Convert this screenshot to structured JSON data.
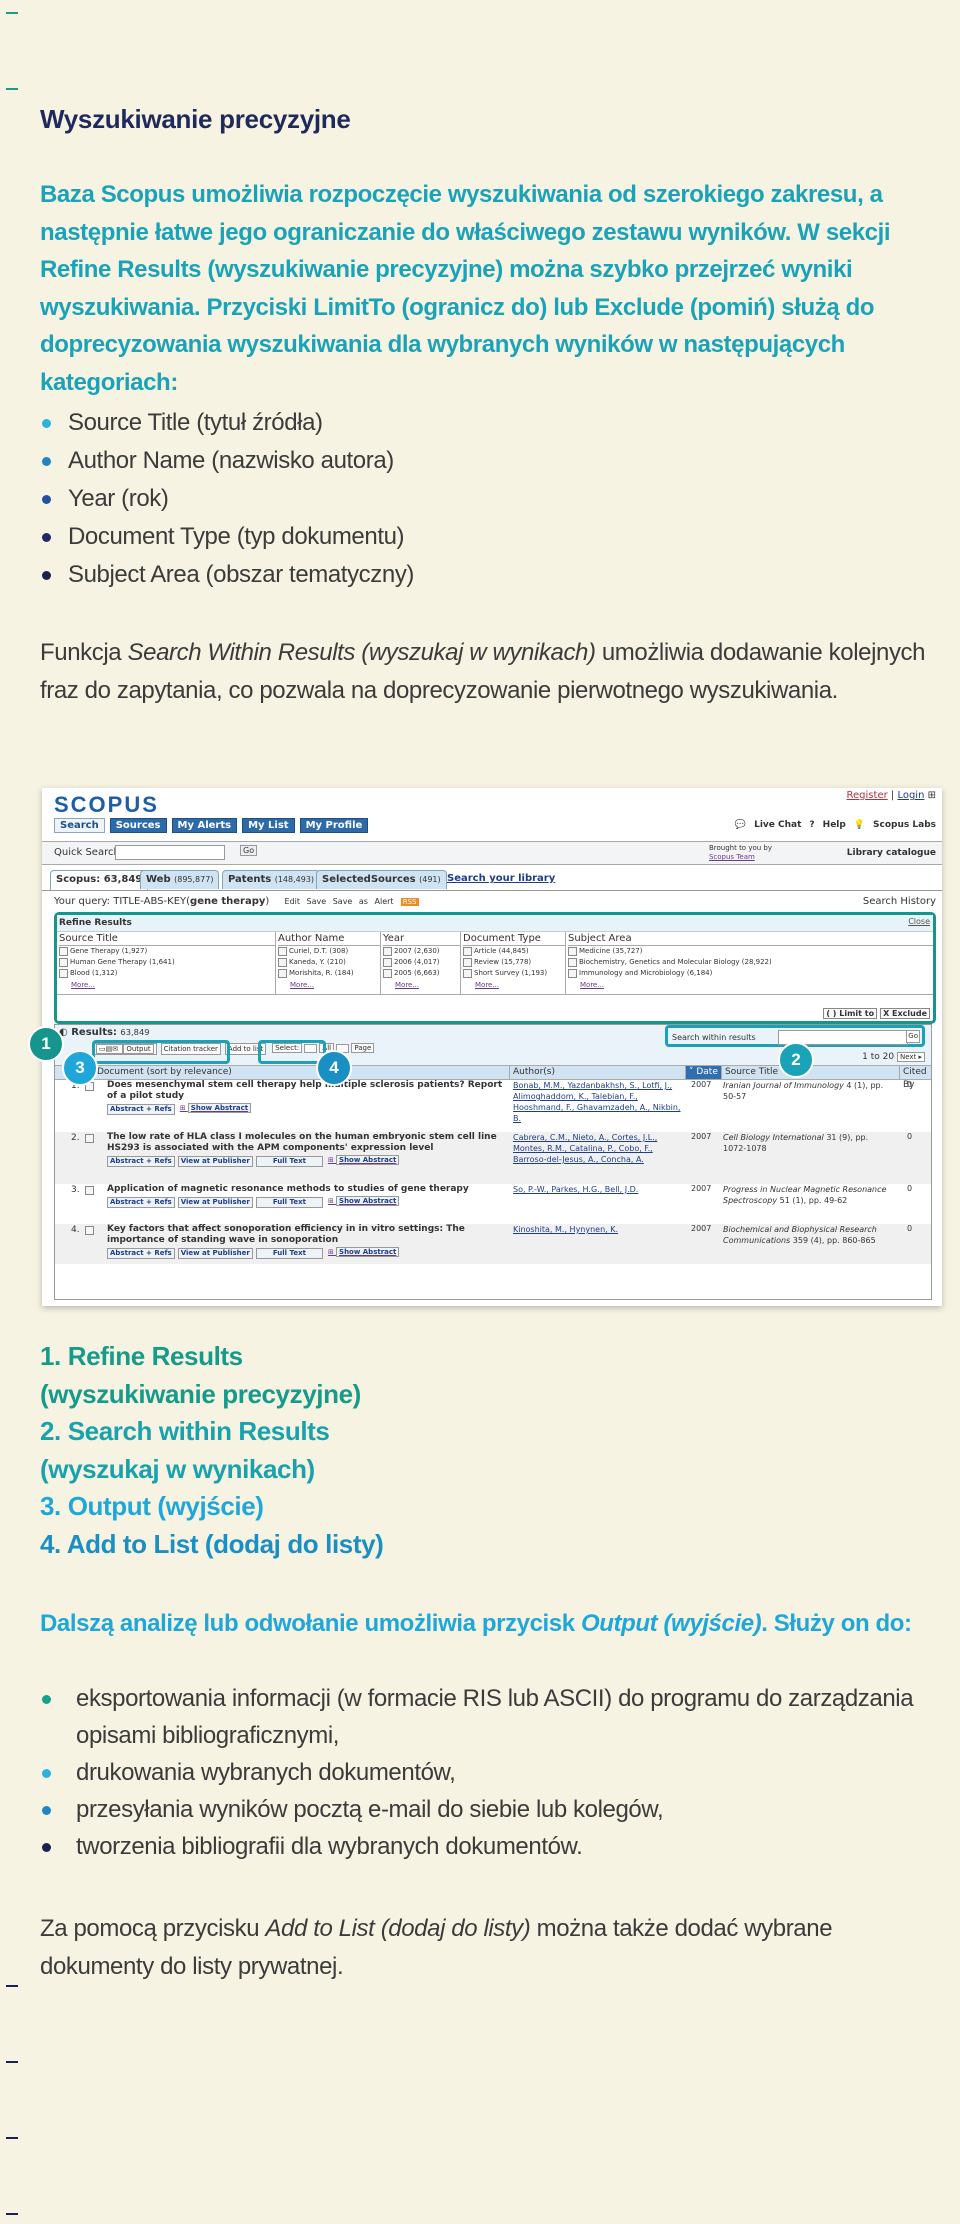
{
  "heading": "Wyszukiwanie precyzyjne",
  "intro": "Baza Scopus umożliwia rozpoczęcie wyszukiwania od szerokiego zakresu, a następnie łatwe jego ograniczanie do właściwego zestawu wyników. W sekcji Refine Results (wyszukiwanie precyzyjne) można szybko przejrzeć wyniki wyszukiwania. Przyciski LimitTo (ogranicz do) lub Exclude (pomiń) służą do doprecyzowania wyszukiwania dla wybranych wyników w następujących kategoriach:",
  "categories": [
    {
      "label": "Source Title (tytuł źródła)",
      "bullet_color": "#29b3e0"
    },
    {
      "label": "Author Name (nazwisko autora)",
      "bullet_color": "#1e86c6"
    },
    {
      "label": "Year (rok)",
      "bullet_color": "#2350a0"
    },
    {
      "label": "Document Type (typ dokumentu)",
      "bullet_color": "#1d2a66"
    },
    {
      "label": "Subject Area (obszar tematyczny)",
      "bullet_color": "#1a2050"
    }
  ],
  "swr_paragraph": {
    "pre": "Funkcja ",
    "italic": "Search Within Results (wyszukaj w wynikach)",
    "post": " umożliwia dodawanie kolejnych fraz do zapytania, co pozwala na doprecyzowanie pierwotnego wyszukiwania."
  },
  "scopus": {
    "logo": "SCOPUS",
    "register": "Register",
    "login": "Login",
    "nav": [
      "Search",
      "Sources",
      "My Alerts",
      "My List",
      "My Profile"
    ],
    "help_links": [
      "Live Chat",
      "Help",
      "Scopus Labs"
    ],
    "quick_search_label": "Quick Search",
    "go": "Go",
    "brought_by": "Brought to you by",
    "brought_team": "Scopus Team",
    "library_catalogue": "Library catalogue",
    "tabs": [
      {
        "label": "Scopus:",
        "count": "63,849"
      },
      {
        "label": "Web",
        "count": "(895,877)"
      },
      {
        "label": "Patents",
        "count": "(148,493)"
      },
      {
        "label": "SelectedSources",
        "count": "(491)"
      }
    ],
    "search_library": "Search your library",
    "query_label": "Your query: TITLE-ABS-KEY(",
    "query_term": "gene therapy",
    "query_close": ")",
    "query_actions": "Edit Save Save as Alert",
    "rss": "RSS",
    "search_history": "Search History",
    "refine": {
      "title": "Refine Results",
      "close": "Close",
      "columns": [
        {
          "header": "Source Title",
          "items": [
            "Gene Therapy (1,927)",
            "Human Gene Therapy (1,641)",
            "Blood (1,312)"
          ]
        },
        {
          "header": "Author Name",
          "items": [
            "Curiel, D.T. (308)",
            "Kaneda, Y. (210)",
            "Morishita, R. (184)"
          ]
        },
        {
          "header": "Year",
          "items": [
            "2007 (2,630)",
            "2006 (4,017)",
            "2005 (6,663)"
          ]
        },
        {
          "header": "Document Type",
          "items": [
            "Article (44,845)",
            "Review (15,778)",
            "Short Survey (1,193)"
          ]
        },
        {
          "header": "Subject Area",
          "items": [
            "Medicine (35,727)",
            "Biochemistry, Genetics and Molecular Biology (28,922)",
            "Immunology and Microbiology (6,184)"
          ]
        }
      ],
      "more": "More...",
      "limit_to": "( ) Limit to",
      "exclude": "X Exclude"
    },
    "results": {
      "label": "Results:",
      "count": "63,849",
      "output": "Output",
      "citation_tracker": "Citation tracker",
      "add_to_list": "Add to list",
      "select": "Select:",
      "all": "All",
      "page": "Page",
      "search_within": "Search within results",
      "go": "Go",
      "pager": "1 to 20",
      "next": "Next ▸",
      "columns": [
        "Document (sort by relevance)",
        "Author(s)",
        "˅ Date",
        "Source Title",
        "Cited By"
      ],
      "rows": [
        {
          "n": "1.",
          "title": "Does mesenchymal stem cell therapy help multiple sclerosis patients? Report of a pilot study",
          "buttons": [
            "Abstract + Refs"
          ],
          "show": "Show Abstract",
          "authors": "Bonab, M.M., Yazdanbakhsh, S., Lotfi, J., Alimoghaddom, K., Talebian, F., Hooshmand, F., Ghavamzadeh, A., Nikbin, B.",
          "year": "2007",
          "source_italic": "Iranian Journal of Immunology",
          "source_rest": " 4 (1), pp. 50-57",
          "cited": "0"
        },
        {
          "n": "2.",
          "title": "The low rate of HLA class I molecules on the human embryonic stem cell line HS293 is associated with the APM components' expression level",
          "buttons": [
            "Abstract + Refs",
            "View at Publisher",
            "Full Text"
          ],
          "show": "Show Abstract",
          "authors": "Cabrera, C.M., Nieto, A., Cortes, J.L., Montes, R.M., Catalina, P., Cobo, F., Barroso-del-Jesus, A., Concha, A.",
          "year": "2007",
          "source_italic": "Cell Biology International",
          "source_rest": " 31 (9), pp. 1072-1078",
          "cited": "0"
        },
        {
          "n": "3.",
          "title": "Application of magnetic resonance methods to studies of gene therapy",
          "buttons": [
            "Abstract + Refs",
            "View at Publisher",
            "Full Text"
          ],
          "show": "Show Abstract",
          "authors": "So, P.-W., Parkes, H.G., Bell, J.D.",
          "year": "2007",
          "source_italic": "Progress in Nuclear Magnetic Resonance Spectroscopy",
          "source_rest": " 51 (1), pp. 49-62",
          "cited": "0"
        },
        {
          "n": "4.",
          "title": "Key factors that affect sonoporation efficiency in in vitro settings: The importance of standing wave in sonoporation",
          "buttons": [
            "Abstract + Refs",
            "View at Publisher",
            "Full Text"
          ],
          "show": "Show Abstract",
          "authors": "Kinoshita, M., Hynynen, K.",
          "year": "2007",
          "source_italic": "Biochemical and Biophysical Research Communications",
          "source_rest": " 359 (4), pp. 860-865",
          "cited": "0"
        }
      ]
    },
    "badges": [
      "1",
      "2",
      "3",
      "4"
    ],
    "badge_colors": {
      "refine": "#16958d",
      "swr": "#1aa3b8",
      "output": "#1ea7d8",
      "add": "#1a8fc4"
    }
  },
  "numbered_list": [
    {
      "text": "1. Refine Results",
      "color": "#169a8a"
    },
    {
      "text": "(wyszukiwanie precyzyjne)",
      "color": "#169a8a"
    },
    {
      "text": "2. Search within Results",
      "color": "#18a2ad"
    },
    {
      "text": "(wyszukaj w wynikach)",
      "color": "#18a2ad"
    },
    {
      "text": "3. Output (wyjście)",
      "color": "#1ea7d8"
    },
    {
      "text": "4. Add to List (dodaj do listy)",
      "color": "#1a8fc4"
    }
  ],
  "output_lead": {
    "pre": "Dalszą analizę lub odwołanie umożliwia przycisk ",
    "italic": "Output (wyjście)",
    "post": ". Służy on do:"
  },
  "uses": [
    {
      "label": "eksportowania informacji (w formacie RIS lub ASCII) do programu do zarządzania opisami bibliograficznymi,",
      "bullet_color": "#16a090"
    },
    {
      "label": "drukowania wybranych dokumentów,",
      "bullet_color": "#29b3e0"
    },
    {
      "label": "przesyłania wyników pocztą e-mail do siebie lub kolegów,",
      "bullet_color": "#1e86c6"
    },
    {
      "label": "tworzenia bibliografii dla wybranych dokumentów.",
      "bullet_color": "#1a2050"
    }
  ],
  "addlist_paragraph": {
    "pre": "Za pomocą przycisku ",
    "italic": "Add to List (dodaj do listy)",
    "post": " można także dodać wybrane dokumenty do listy prywatnej."
  }
}
